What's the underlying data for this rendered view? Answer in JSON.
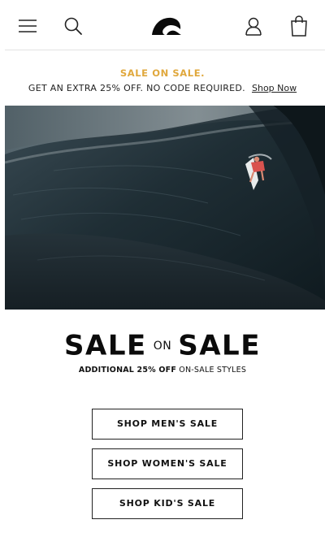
{
  "header": {
    "icons": [
      "menu-icon",
      "search-icon",
      "quiksilver-logo",
      "account-icon",
      "bag-icon"
    ]
  },
  "promo": {
    "title": "SALE ON SALE.",
    "text": "GET AN EXTRA 25% OFF. NO CODE REQUIRED.",
    "link": "Shop Now",
    "title_color": "#e0a83d"
  },
  "hero": {
    "image": "surfer-riding-large-dark-wave"
  },
  "sale": {
    "word_left": "SALE",
    "word_on": "ON",
    "word_right": "SALE",
    "sub_bold": "ADDITIONAL 25% OFF",
    "sub_rest": "ON-SALE STYLES"
  },
  "buttons": {
    "mens": "SHOP MEN'S SALE",
    "womens": "SHOP WOMEN'S SALE",
    "kids": "SHOP KID'S SALE"
  }
}
